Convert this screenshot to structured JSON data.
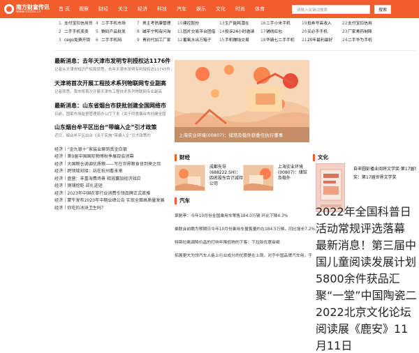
{
  "brand": {
    "title": "南方财富传讯",
    "subtitle": "www.nfcfzx.cn",
    "accent": "#f25d2d"
  },
  "nav": [
    "首 页",
    "观察",
    "财经",
    "关注",
    "经济",
    "科技",
    "汽车",
    "娱乐",
    "文化",
    "时尚",
    "体育"
  ],
  "search": {
    "placeholder": "请输入关键词搜索",
    "button": "搜索"
  },
  "quick_links": [
    [
      "1",
      "支付宝扣信用贷"
    ],
    [
      "4",
      "二手手机市场"
    ],
    [
      "7",
      "男主考债康管理"
    ],
    [
      "10",
      "建控股份"
    ],
    [
      "13",
      "生产能耗潜在"
    ],
    [
      "16",
      "二手小米手机"
    ],
    [
      "19",
      "抵券号高收入"
    ],
    [
      "22",
      "支付宝扣信用"
    ],
    [
      "2",
      "二手手机卖卖"
    ],
    [
      "5",
      "数码产品批发"
    ],
    [
      "8",
      "碱平宁鸭有问淘"
    ],
    [
      "11",
      "固片交易平台团借"
    ],
    [
      "14",
      "投诉24小时邀请"
    ],
    [
      "17",
      "铺线红包"
    ],
    [
      "20",
      "买必手手机"
    ],
    [
      "23",
      "厂家青药制降"
    ],
    [
      "3",
      "cego免费开锁"
    ],
    [
      "6",
      "二手手机网"
    ],
    [
      "9",
      "青钓代加工厂家"
    ],
    [
      "12",
      "蓄氧水出万箱子"
    ],
    [
      "15",
      "手机赚钱交易"
    ],
    [
      "18",
      "华骑七二手手机"
    ],
    [
      "21",
      "20年最利最好"
    ],
    [
      "24",
      "二手华为手机"
    ]
  ],
  "left_news": {
    "items": [
      {
        "headline": "最新消息：去年天津市发明专利授权达1176件",
        "summary": "记者从天津市知识产权局获悉，去年天津市发明专利授权达11745件，"
      },
      {
        "headline": "天津将首次开展工程技术系列物联网专业副高",
        "summary": "记者获悉，我市将首次开展天津市工程技术系列物联网专业副高"
      },
      {
        "headline": "最新消息：山东省烟台市获批创建全国网络市",
        "summary": "日前，国家市场监督管理局办公厅下发《关于同意烟台市创建全国"
      },
      {
        "headline": "山东烟台牟平区出台“带编入企”引才政策",
        "summary": "近日，烟台牟平区出台《关于实施“带编入企”引才政策的"
      }
    ],
    "list": [
      {
        "tag": "经济",
        "text": "“金九银十”家装业聊到真金白银"
      },
      {
        "tag": "经济",
        "text": "第9届中国国际物博秋季展现会闭幕"
      },
      {
        "tag": "经济",
        "text": "大国粮仓调调优质粮——写在世界粮食日到来之际"
      },
      {
        "tag": "经济",
        "text": "跨领域对接：站在杭州看未来"
      },
      {
        "tag": "经济",
        "text": "盘营：丰富海费场景 释放赢加经济效应"
      },
      {
        "tag": "经济",
        "text": "钢铺挖贬 却扎迎运"
      },
      {
        "tag": "经济",
        "text": "2023年中国农寧行业消费引领品牌正式首推"
      },
      {
        "tag": "经济",
        "text": "蒙牛发布2023年中期业绩公告 实现全面高质量发展"
      },
      {
        "tag": "经济",
        "text": "你吃的冰块卫生吗？"
      }
    ]
  },
  "banner": {
    "caption": "上海实业环境(00807)：储馆及稳外获委任执行董事"
  },
  "finance": {
    "label": "财经",
    "items": [
      {
        "text": "成都先导(688222.SH)：四名股东合计减持公司"
      },
      {
        "text": "上海实业环境(00807)：储馆及稳外"
      }
    ]
  },
  "car": {
    "label": "汽车",
    "items": [
      {
        "text": "莱驰亭：今年10月份全国乘用车零售184.0万辆 环比下降4.3%"
      },
      {
        "text": "乘联会前瞻为预期日今年10月份乘用车量售量约在184.5万辆，同比增长7.2%，"
      },
      {
        "text": "特斯拉离调降价昌的打响年降低物的下客：下拉除优惠审细"
      },
      {
        "text": "拓展更大为领汽车人能上行业成分的优质是在上周，对于中国品牌汽车用，于"
      }
    ]
  },
  "culture": {
    "label": "文化",
    "items": [
      {
        "text": "自丰圆彭播业阅将文学奖·第17届世界文学奖"
      },
      {
        "text": "奖：第17届世界文学奖"
      },
      {
        "text": "2022年全国科普日活动常规评选落幕"
      },
      {
        "text": "最新消息！第三届中国儿童阅读发展计划"
      },
      {
        "text": "5800余件获品汇聚“一堂”中国陶瓷二"
      },
      {
        "text": "2022北京文化论坛阅读展《鹿安》11月11日"
      }
    ]
  }
}
